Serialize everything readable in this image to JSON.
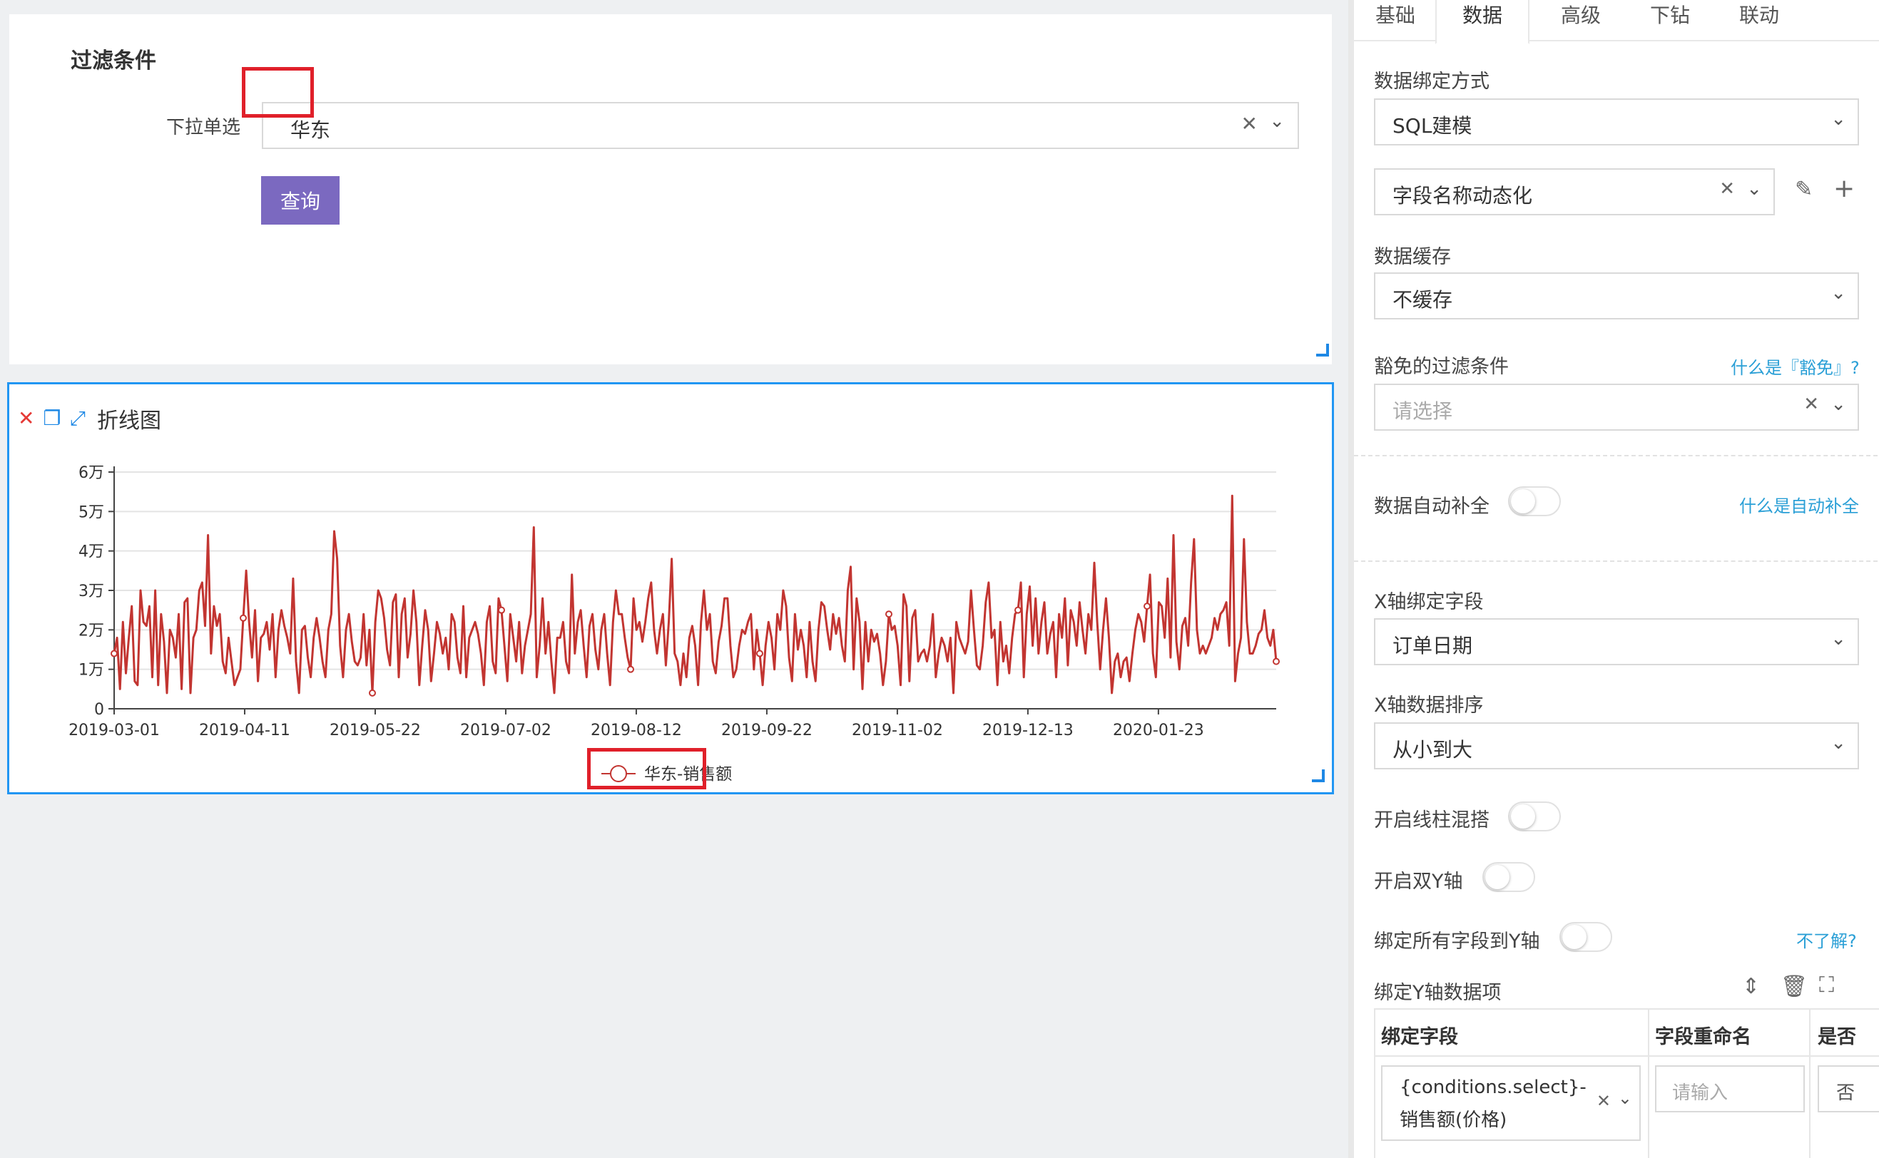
{
  "filter": {
    "title": "过滤条件",
    "label": "下拉单选",
    "selected_value": "华东",
    "query_button": "查询"
  },
  "chart_panel": {
    "title": "折线图"
  },
  "colors": {
    "accent": "#7b69c0",
    "line": "#c23531",
    "selection": "#2196f3",
    "highlight": "#e0202a",
    "link": "#2a9fd6"
  },
  "chart_data": {
    "type": "line",
    "title": "",
    "xlabel": "",
    "ylabel": "",
    "x_tick_labels": [
      "2019-03-01",
      "2019-04-11",
      "2019-05-22",
      "2019-07-02",
      "2019-08-12",
      "2019-09-22",
      "2019-11-02",
      "2019-12-13",
      "2020-01-23"
    ],
    "y_tick_labels": [
      "0",
      "1万",
      "2万",
      "3万",
      "4万",
      "5万",
      "6万"
    ],
    "ylim": [
      0,
      60000
    ],
    "x_range": [
      "2019-03-01",
      "2020-02-29"
    ],
    "grid": true,
    "legend_position": "bottom-center",
    "series": [
      {
        "name": "华东-销售额",
        "start_date": "2019-03-01",
        "interval_days": 1,
        "values": [
          14000,
          18000,
          5000,
          22000,
          9000,
          18000,
          26000,
          7000,
          6000,
          30000,
          22000,
          21000,
          26000,
          8000,
          30000,
          6000,
          24000,
          17000,
          4000,
          20000,
          18000,
          13000,
          24000,
          5000,
          27000,
          28000,
          4000,
          18000,
          20000,
          30000,
          32000,
          21000,
          44000,
          14000,
          26000,
          21000,
          24000,
          12000,
          9000,
          18000,
          12000,
          6000,
          8000,
          10000,
          23000,
          35000,
          22000,
          13000,
          25000,
          7000,
          18000,
          19000,
          22000,
          15000,
          24000,
          8000,
          20000,
          25000,
          21000,
          18000,
          14000,
          33000,
          12000,
          4000,
          20000,
          21000,
          13000,
          8000,
          18000,
          23000,
          18000,
          12000,
          8000,
          20000,
          24000,
          45000,
          38000,
          16000,
          8000,
          20000,
          24000,
          17000,
          12000,
          11000,
          13000,
          24000,
          11000,
          20000,
          4000,
          22000,
          30000,
          28000,
          23000,
          15000,
          11000,
          27000,
          29000,
          8000,
          24000,
          28000,
          13000,
          19000,
          30000,
          22000,
          6000,
          16000,
          25000,
          20000,
          7000,
          14000,
          22000,
          19000,
          14000,
          18000,
          10000,
          24000,
          22000,
          13000,
          9000,
          26000,
          8000,
          18000,
          20000,
          22000,
          19000,
          14000,
          6000,
          22000,
          26000,
          12000,
          9000,
          28000,
          25000,
          16000,
          7000,
          24000,
          18000,
          12000,
          22000,
          9000,
          16000,
          20000,
          24000,
          46000,
          8000,
          16000,
          28000,
          14000,
          22000,
          12000,
          4000,
          18000,
          18000,
          22000,
          12000,
          9000,
          34000,
          14000,
          22000,
          25000,
          16000,
          8000,
          21000,
          24000,
          15000,
          10000,
          20000,
          24000,
          14000,
          6000,
          22000,
          30000,
          24000,
          24000,
          18000,
          13000,
          10000,
          28000,
          20000,
          22000,
          17000,
          22000,
          28000,
          32000,
          20000,
          14000,
          20000,
          24000,
          11000,
          22000,
          38000,
          14000,
          12000,
          6000,
          14000,
          8000,
          18000,
          21000,
          16000,
          6000,
          22000,
          30000,
          20000,
          24000,
          12000,
          9000,
          17000,
          21000,
          28000,
          28000,
          16000,
          8000,
          10000,
          16000,
          20000,
          19000,
          22000,
          24000,
          10000,
          20000,
          14000,
          6000,
          16000,
          22000,
          18000,
          10000,
          24000,
          20000,
          30000,
          26000,
          13000,
          7000,
          24000,
          15000,
          20000,
          16000,
          8000,
          22000,
          12000,
          7000,
          20000,
          27000,
          26000,
          20000,
          15000,
          24000,
          19000,
          23000,
          16000,
          12000,
          30000,
          36000,
          10000,
          28000,
          22000,
          5000,
          22000,
          12000,
          20000,
          17000,
          19000,
          14000,
          6000,
          12000,
          24000,
          20000,
          21000,
          16000,
          6000,
          29000,
          26000,
          7000,
          23000,
          25000,
          12000,
          14000,
          15000,
          12000,
          16000,
          24000,
          8000,
          14000,
          18000,
          16000,
          12000,
          18000,
          4000,
          22000,
          18000,
          16000,
          14000,
          17000,
          30000,
          20000,
          11000,
          10000,
          16000,
          27000,
          32000,
          18000,
          20000,
          6000,
          22000,
          12000,
          16000,
          9000,
          18000,
          24000,
          25000,
          32000,
          8000,
          24000,
          31000,
          16000,
          28000,
          14000,
          22000,
          27000,
          14000,
          19000,
          22000,
          8000,
          24000,
          18000,
          28000,
          11000,
          25000,
          22000,
          16000,
          27000,
          20000,
          14000,
          24000,
          20000,
          37000,
          22000,
          10000,
          20000,
          28000,
          18000,
          4000,
          12000,
          14000,
          8000,
          12000,
          13000,
          7000,
          14000,
          20000,
          24000,
          22000,
          17000,
          26000,
          34000,
          14000,
          8000,
          27000,
          26000,
          18000,
          33000,
          13000,
          44000,
          17000,
          10000,
          21000,
          23000,
          16000,
          32000,
          43000,
          20000,
          14000,
          16000,
          14000,
          16000,
          18000,
          23000,
          20000,
          24000,
          25000,
          27000,
          16000,
          54000,
          7000,
          14000,
          18000,
          43000,
          22000,
          14000,
          14000,
          16000,
          19000,
          20000,
          25000,
          18000,
          16000,
          20000,
          12000
        ],
        "note": "values sampled at regular intervals across the x range"
      }
    ]
  },
  "right_panel": {
    "tabs": [
      "基础",
      "数据",
      "高级",
      "下钻",
      "联动"
    ],
    "active_tab": "数据",
    "binding_mode_label": "数据绑定方式",
    "binding_mode_value": "SQL建模",
    "dataset_value": "字段名称动态化",
    "cache_label": "数据缓存",
    "cache_value": "不缓存",
    "exempt_filter_label": "豁免的过滤条件",
    "exempt_filter_help": "什么是『豁免』?",
    "exempt_filter_placeholder": "请选择",
    "auto_fill_label": "数据自动补全",
    "auto_fill_help": "什么是自动补全",
    "x_field_label": "X轴绑定字段",
    "x_field_value": "订单日期",
    "x_sort_label": "X轴数据排序",
    "x_sort_value": "从小到大",
    "mix_label": "开启线柱混搭",
    "dual_y_label": "开启双Y轴",
    "bind_all_label": "绑定所有字段到Y轴",
    "bind_all_help": "不了解?",
    "y_items_label": "绑定Y轴数据项",
    "table": {
      "headers": [
        "绑定字段",
        "字段重命名",
        "是否"
      ],
      "rows": [
        {
          "field_line1": "{conditions.select}-",
          "field_line2": "销售额(价格)",
          "rename_placeholder": "请输入",
          "flag": "否"
        }
      ]
    }
  }
}
